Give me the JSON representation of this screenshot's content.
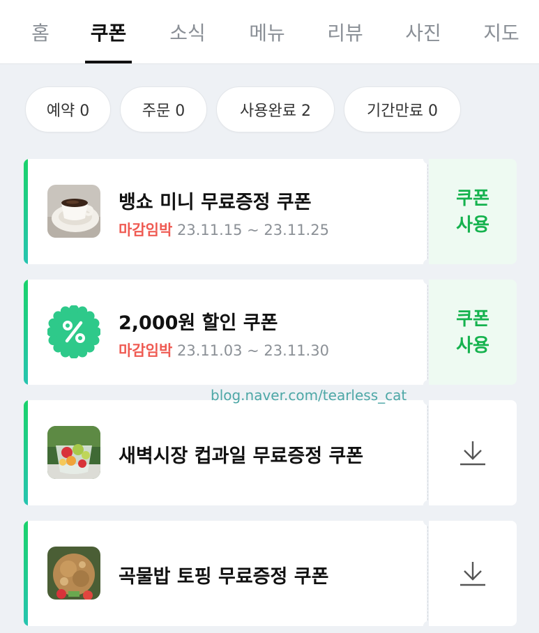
{
  "tabs": [
    {
      "label": "홈"
    },
    {
      "label": "쿠폰"
    },
    {
      "label": "소식"
    },
    {
      "label": "메뉴"
    },
    {
      "label": "리뷰"
    },
    {
      "label": "사진"
    },
    {
      "label": "지도"
    }
  ],
  "active_tab": "쿠폰",
  "filters": [
    {
      "label": "예약 0"
    },
    {
      "label": "주문 0"
    },
    {
      "label": "사용완료 2"
    },
    {
      "label": "기간만료 0"
    }
  ],
  "coupons": [
    {
      "title": "뱅쇼 미니 무료증정 쿠폰",
      "urgent": "마감임박",
      "period": "23.11.15 ~ 23.11.25",
      "action": "쿠폰\n사용",
      "image": "coffee-cup-image"
    },
    {
      "title": "2,000원 할인 쿠폰",
      "urgent": "마감임박",
      "period": "23.11.03 ~ 23.11.30",
      "action": "쿠폰\n사용",
      "image": "percent-badge-icon"
    },
    {
      "title": "새벽시장 컵과일 무료증정 쿠폰",
      "action_icon": "download-icon",
      "image": "fruit-cup-image"
    },
    {
      "title": "곡물밥 토핑 무료증정 쿠폰",
      "action_icon": "download-icon",
      "image": "grain-rice-image"
    }
  ],
  "watermark": "blog.naver.com/tearless_cat",
  "colors": {
    "accent_green": "#15b24e",
    "urgent_red": "#ef5a52",
    "background": "#eef1f5",
    "badge_green": "#2ec98a"
  }
}
